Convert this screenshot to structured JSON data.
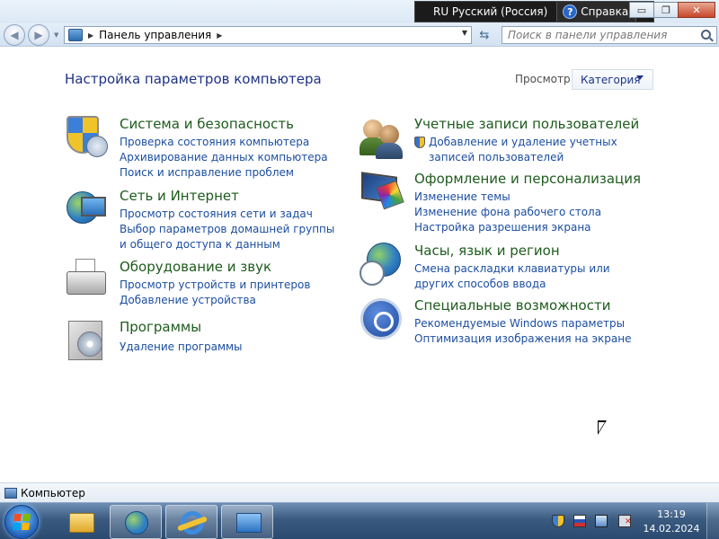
{
  "language_bar": {
    "language": "RU Русский (Россия)",
    "help_label": "Справка"
  },
  "window_controls": {
    "minimize": "▭",
    "maximize": "❐",
    "close": "✕"
  },
  "navigation": {
    "breadcrumb": "Панель управления",
    "search_placeholder": "Поиск в панели управления"
  },
  "header": {
    "title": "Настройка параметров компьютера",
    "view_by_label": "Просмотр:",
    "view_by_value": "Категория"
  },
  "categories_left": [
    {
      "title": "Система и безопасность",
      "icon": "shield-icon",
      "links": [
        "Проверка состояния компьютера",
        "Архивирование данных компьютера",
        "Поиск и исправление проблем"
      ]
    },
    {
      "title": "Сеть и Интернет",
      "icon": "network-globe-icon",
      "links": [
        "Просмотр состояния сети и задач",
        "Выбор параметров домашней группы и общего доступа к данным"
      ]
    },
    {
      "title": "Оборудование и звук",
      "icon": "printer-icon",
      "links": [
        "Просмотр устройств и принтеров",
        "Добавление устройства"
      ]
    },
    {
      "title": "Программы",
      "icon": "programs-disc-icon",
      "links": [
        "Удаление программы"
      ]
    }
  ],
  "categories_right": [
    {
      "title": "Учетные записи пользователей",
      "icon": "users-icon",
      "links": [
        "Добавление и удаление учетных записей пользователей"
      ]
    },
    {
      "title": "Оформление и персонализация",
      "icon": "personalization-icon",
      "links": [
        "Изменение темы",
        "Изменение фона рабочего стола",
        "Настройка разрешения экрана"
      ]
    },
    {
      "title": "Часы, язык и регион",
      "icon": "clock-globe-icon",
      "links": [
        "Смена раскладки клавиатуры или других способов ввода"
      ]
    },
    {
      "title": "Специальные возможности",
      "icon": "accessibility-icon",
      "links": [
        "Рекомендуемые Windows параметры",
        "Оптимизация изображения на экране"
      ]
    }
  ],
  "details_pane": {
    "label": "Компьютер"
  },
  "taskbar": {
    "time": "13:19",
    "date": "14.02.2024",
    "pinned": [
      "folder-icon",
      "network-icon",
      "internet-explorer-icon",
      "control-panel-icon"
    ]
  },
  "colors": {
    "category_title": "#1e5b1e",
    "link": "#1c4ea0",
    "page_title": "#1e3287"
  }
}
